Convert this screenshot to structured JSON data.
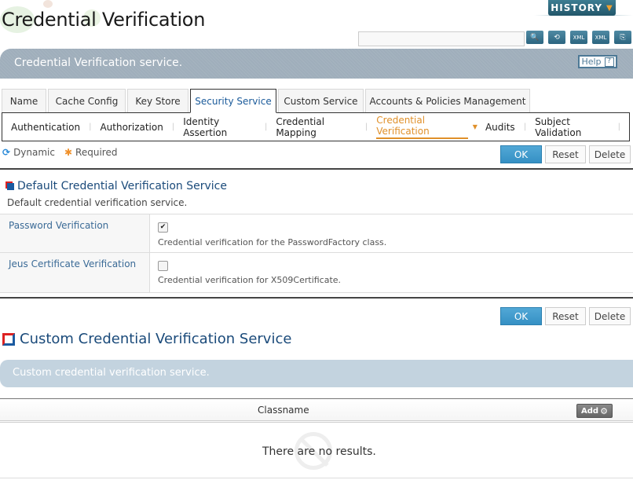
{
  "header": {
    "title": "Credential Verification",
    "history_label": "HISTORY",
    "search_placeholder": "",
    "toolbar_icons": [
      "search-icon",
      "reload-icon",
      "xml-export-icon",
      "xml-import-icon",
      "copy-icon"
    ],
    "banner_text": "Credential Verification service.",
    "help_label": "Help",
    "help_icon_glyph": "?"
  },
  "tabs": [
    {
      "label": "Name",
      "active": false
    },
    {
      "label": "Cache Config",
      "active": false
    },
    {
      "label": "Key Store",
      "active": false
    },
    {
      "label": "Security Service",
      "active": true
    },
    {
      "label": "Custom Service",
      "active": false
    },
    {
      "label": "Accounts & Policies Management",
      "active": false
    }
  ],
  "subnav": [
    {
      "label": "Authentication"
    },
    {
      "label": "Authorization"
    },
    {
      "label": "Identity Assertion"
    },
    {
      "label": "Credential Mapping"
    },
    {
      "label": "Credential Verification",
      "active": true
    },
    {
      "label": "Audits"
    },
    {
      "label": "Subject Validation"
    }
  ],
  "legend": {
    "dynamic": "Dynamic",
    "required": "Required"
  },
  "buttons": {
    "ok": "OK",
    "reset": "Reset",
    "delete": "Delete"
  },
  "default_section": {
    "title": "Default Credential Verification Service",
    "description": "Default credential verification service.",
    "rows": [
      {
        "label": "Password Verification",
        "checked": true,
        "check_glyph": "✔",
        "description": "Credential verification for the PasswordFactory class."
      },
      {
        "label": "Jeus Certificate Verification",
        "checked": false,
        "check_glyph": "",
        "description": "Credential verification for X509Certificate."
      }
    ]
  },
  "custom_section": {
    "title": "Custom Credential Verification Service",
    "banner_text": "Custom credential verification service.",
    "column_header": "Classname",
    "add_label": "Add",
    "empty_text": "There are no results."
  },
  "colors": {
    "accent": "#e0902a",
    "ok_button": "#3d9acb",
    "title_blue": "#1a4a7a"
  }
}
